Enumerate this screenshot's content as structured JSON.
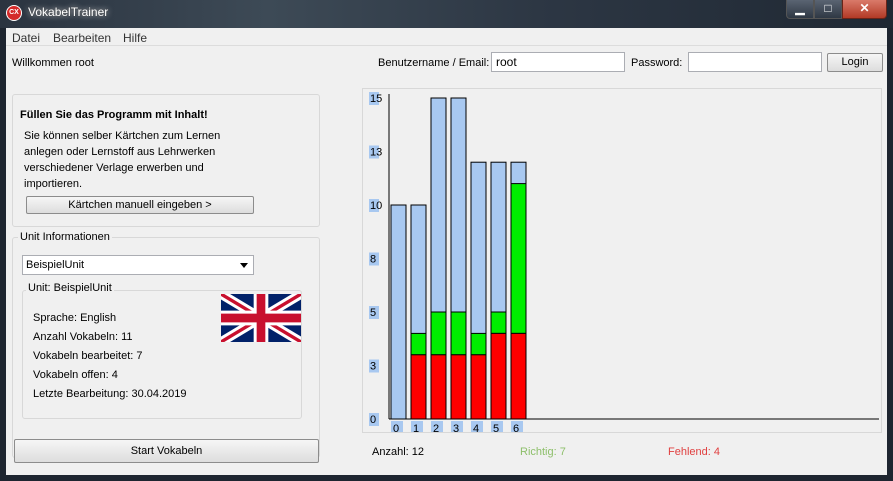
{
  "window": {
    "title": "VokabelTrainer",
    "icon_text": "CX"
  },
  "menu": [
    "Datei",
    "Bearbeiten",
    "Hilfe"
  ],
  "header": {
    "welcome": "Willkommen root",
    "username_label": "Benutzername / Email:",
    "username_value": "root",
    "password_label": "Password:",
    "password_value": "",
    "login_label": "Login"
  },
  "promo": {
    "title": "Füllen Sie das Programm mit Inhalt!",
    "lines": [
      "Sie können selber Kärtchen zum Lernen",
      "anlegen oder Lernstoff aus Lehrwerken",
      "verschiedener Verlage erwerben und",
      "importieren."
    ],
    "button": "Kärtchen manuell eingeben >"
  },
  "unit": {
    "group_title": "Unit Informationen",
    "selected": "BeispielUnit",
    "details_title": "Unit: BeispielUnit",
    "language": "Sprache: English",
    "count": "Anzahl Vokabeln: 11",
    "edited": "Vokabeln bearbeitet: 7",
    "open": "Vokabeln offen: 4",
    "last_edit": "Letzte Bearbeitung: 30.04.2019",
    "flag": "uk-flag-icon"
  },
  "start_button": "Start Vokabeln",
  "status": {
    "count": "Anzahl: 12",
    "correct": "Richtig: 7",
    "missing": "Fehlend: 4"
  },
  "colors": {
    "total": "#a8c8f0",
    "correct": "#00ee00",
    "missing": "#ff0000",
    "correct_text": "#8dbf6a",
    "missing_text": "#e04040"
  },
  "chart_data": {
    "type": "bar",
    "categories": [
      "0",
      "1",
      "2",
      "3",
      "4",
      "5",
      "6"
    ],
    "y_ticks": [
      "0",
      "3",
      "5",
      "8",
      "10",
      "13",
      "15"
    ],
    "ylim": [
      0,
      15
    ],
    "series": [
      {
        "key": "missing",
        "values": [
          0,
          3,
          3,
          3,
          3,
          4,
          4
        ]
      },
      {
        "key": "correct",
        "values": [
          0,
          1,
          2,
          2,
          1,
          1,
          7
        ]
      },
      {
        "key": "total",
        "values": [
          10,
          10,
          15,
          15,
          12,
          12,
          12
        ]
      }
    ]
  }
}
